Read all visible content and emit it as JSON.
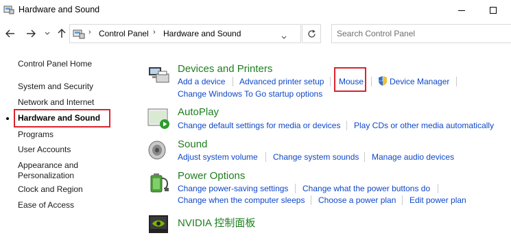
{
  "window": {
    "title": "Hardware and Sound"
  },
  "navigation": {
    "breadcrumbs": [
      "Control Panel",
      "Hardware and Sound"
    ],
    "search_placeholder": "Search Control Panel"
  },
  "sidebar": {
    "items": [
      {
        "label": "Control Panel Home"
      },
      {
        "label": "System and Security"
      },
      {
        "label": "Network and Internet"
      },
      {
        "label": "Hardware and Sound",
        "current": true
      },
      {
        "label": "Programs"
      },
      {
        "label": "User Accounts"
      },
      {
        "label": "Appearance and Personalization"
      },
      {
        "label": "Clock and Region"
      },
      {
        "label": "Ease of Access"
      }
    ]
  },
  "categories": [
    {
      "title": "Devices and Printers",
      "icon": "printer-icon",
      "links": [
        "Add a device",
        "Advanced printer setup",
        "Mouse",
        "Device Manager",
        "Change Windows To Go startup options"
      ]
    },
    {
      "title": "AutoPlay",
      "icon": "autoplay-icon",
      "links": [
        "Change default settings for media or devices",
        "Play CDs or other media automatically"
      ]
    },
    {
      "title": "Sound",
      "icon": "speaker-icon",
      "links": [
        "Adjust system volume",
        "Change system sounds",
        "Manage audio devices"
      ]
    },
    {
      "title": "Power Options",
      "icon": "battery-icon",
      "links": [
        "Change power-saving settings",
        "Change what the power buttons do",
        "Change when the computer sleeps",
        "Choose a power plan",
        "Edit power plan"
      ]
    },
    {
      "title": "NVIDIA 控制面板",
      "icon": "nvidia-icon",
      "links": []
    }
  ],
  "colors": {
    "category_title": "#1e7e1e",
    "link": "#0d47c8",
    "highlight": "#d9232d"
  }
}
